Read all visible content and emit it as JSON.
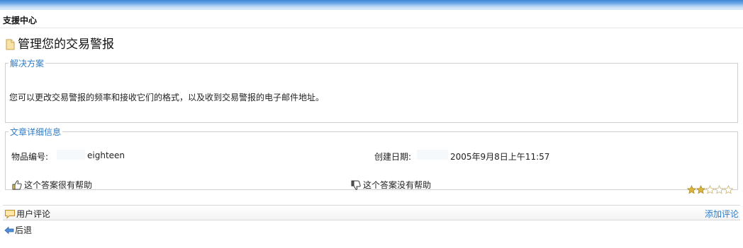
{
  "header": {
    "section_title": "支援中心",
    "page_title": "管理您的交易警报"
  },
  "solution": {
    "legend": "解决方案",
    "text": "您可以更改交易警报的频率和接收它们的格式，以及收到交易警报的电子邮件地址。"
  },
  "details": {
    "legend": "文章详细信息",
    "item_number_label": "物品编号:",
    "item_number_value": "eighteen",
    "created_date_label": "创建日期:",
    "created_date_value": "2005年9月8日上午11:57",
    "helpful_label": "这个答案很有帮助",
    "not_helpful_label": "这个答案没有帮助",
    "rating": {
      "filled": 2,
      "total": 5
    }
  },
  "comments": {
    "label": "用户评论",
    "add_label": "添加评论"
  },
  "nav": {
    "back_label": "后退"
  },
  "colors": {
    "accent": "#2f7cc6",
    "topbar": "#3f86d6",
    "star_filled": "#d9b43a"
  },
  "icons": {
    "title": "document-icon",
    "helpful": "thumbs-up-icon",
    "not_helpful": "thumbs-down-icon",
    "comments": "comment-icon",
    "back": "back-arrow-icon",
    "rating": "star-icon"
  }
}
